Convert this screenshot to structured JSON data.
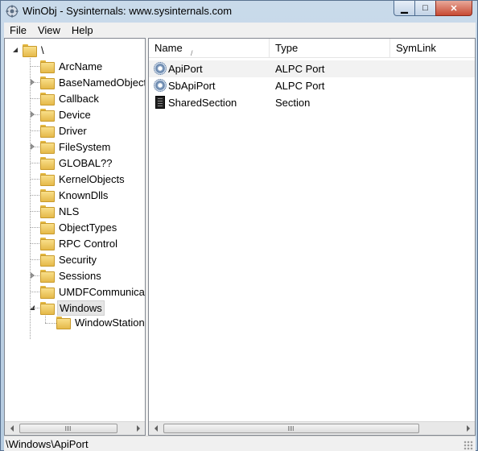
{
  "window": {
    "title": "WinObj - Sysinternals: www.sysinternals.com",
    "minimize_glyph": "▁",
    "maximize_glyph": "□",
    "close_glyph": "✕"
  },
  "menu": [
    "File",
    "View",
    "Help"
  ],
  "tree": {
    "root": "\\",
    "items": [
      {
        "label": "ArcName",
        "expandable": false
      },
      {
        "label": "BaseNamedObjects",
        "expandable": true
      },
      {
        "label": "Callback",
        "expandable": false
      },
      {
        "label": "Device",
        "expandable": true
      },
      {
        "label": "Driver",
        "expandable": false
      },
      {
        "label": "FileSystem",
        "expandable": true
      },
      {
        "label": "GLOBAL??",
        "expandable": false
      },
      {
        "label": "KernelObjects",
        "expandable": false
      },
      {
        "label": "KnownDlls",
        "expandable": false
      },
      {
        "label": "NLS",
        "expandable": false
      },
      {
        "label": "ObjectTypes",
        "expandable": false
      },
      {
        "label": "RPC Control",
        "expandable": false
      },
      {
        "label": "Security",
        "expandable": false
      },
      {
        "label": "Sessions",
        "expandable": true
      },
      {
        "label": "UMDFCommunicationPorts",
        "expandable": false
      },
      {
        "label": "Windows",
        "expandable": true,
        "expanded": true,
        "selected": true
      }
    ],
    "child": "WindowStations"
  },
  "list": {
    "columns": [
      "Name",
      "Type",
      "SymLink"
    ],
    "sort_indicator": "/",
    "rows": [
      {
        "name": "ApiPort",
        "type": "ALPC Port",
        "symlink": "",
        "icon": "alpc-port-icon"
      },
      {
        "name": "SbApiPort",
        "type": "ALPC Port",
        "symlink": "",
        "icon": "alpc-port-icon"
      },
      {
        "name": "SharedSection",
        "type": "Section",
        "symlink": "",
        "icon": "section-icon"
      }
    ]
  },
  "status": "\\Windows\\ApiPort",
  "colors": {
    "title_bg": "#c9daea",
    "close_button": "#c74a33",
    "folder": "#e5b94a"
  }
}
